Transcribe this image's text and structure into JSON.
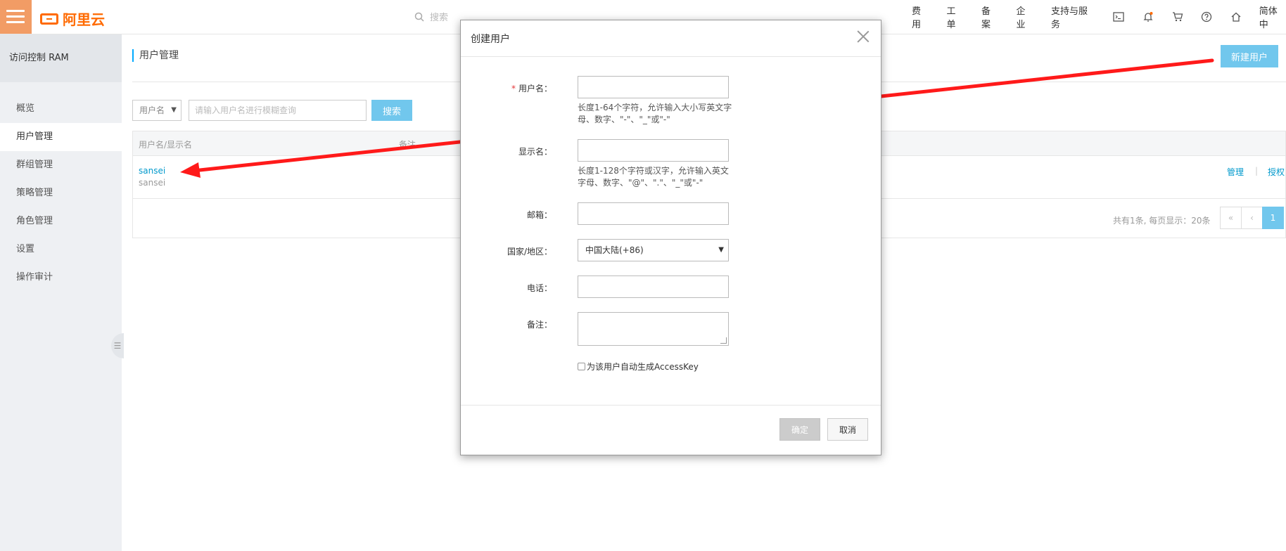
{
  "topbar": {
    "logo_text": "阿里云",
    "search_placeholder": "搜索",
    "nav": [
      "费用",
      "工单",
      "备案",
      "企业",
      "支持与服务"
    ],
    "lang": "简体中"
  },
  "sidebar": {
    "title": "访问控制 RAM",
    "items": [
      "概览",
      "用户管理",
      "群组管理",
      "策略管理",
      "角色管理",
      "设置",
      "操作审计"
    ]
  },
  "main": {
    "breadcrumb": "用户管理",
    "new_user_button": "新建用户",
    "filter_select": "用户名",
    "filter_placeholder": "请输入用户名进行模糊查询",
    "search_button": "搜索",
    "table": {
      "headers": [
        "用户名/显示名",
        "备注"
      ],
      "rows": [
        {
          "name": "sansei",
          "display": "sansei",
          "actions": [
            "管理",
            "授权"
          ]
        }
      ]
    },
    "pager": {
      "summary": "共有1条, 每页显示：20条",
      "first": "«",
      "prev": "‹",
      "current": "1"
    }
  },
  "modal": {
    "title": "创建用户",
    "fields": {
      "username": {
        "label": "用户名：",
        "required": "*",
        "hint": "长度1-64个字符，允许输入大小写英文字母、数字、\"-\"、\"_\"或\"-\""
      },
      "display_name": {
        "label": "显示名：",
        "hint": "长度1-128个字符或汉字，允许输入英文字母、数字、\"@\"、\".\"、\"_\"或\"-\""
      },
      "email": {
        "label": "邮箱："
      },
      "country": {
        "label": "国家/地区：",
        "value": "中国大陆(+86)"
      },
      "phone": {
        "label": "电话："
      },
      "remark": {
        "label": "备注："
      }
    },
    "checkbox_label": "为该用户自动生成AccessKey",
    "ok_button": "确定",
    "cancel_button": "取消"
  },
  "colors": {
    "accent": "#71c7ed",
    "brand": "#ff6a00",
    "arrow": "#ff1a1a"
  }
}
